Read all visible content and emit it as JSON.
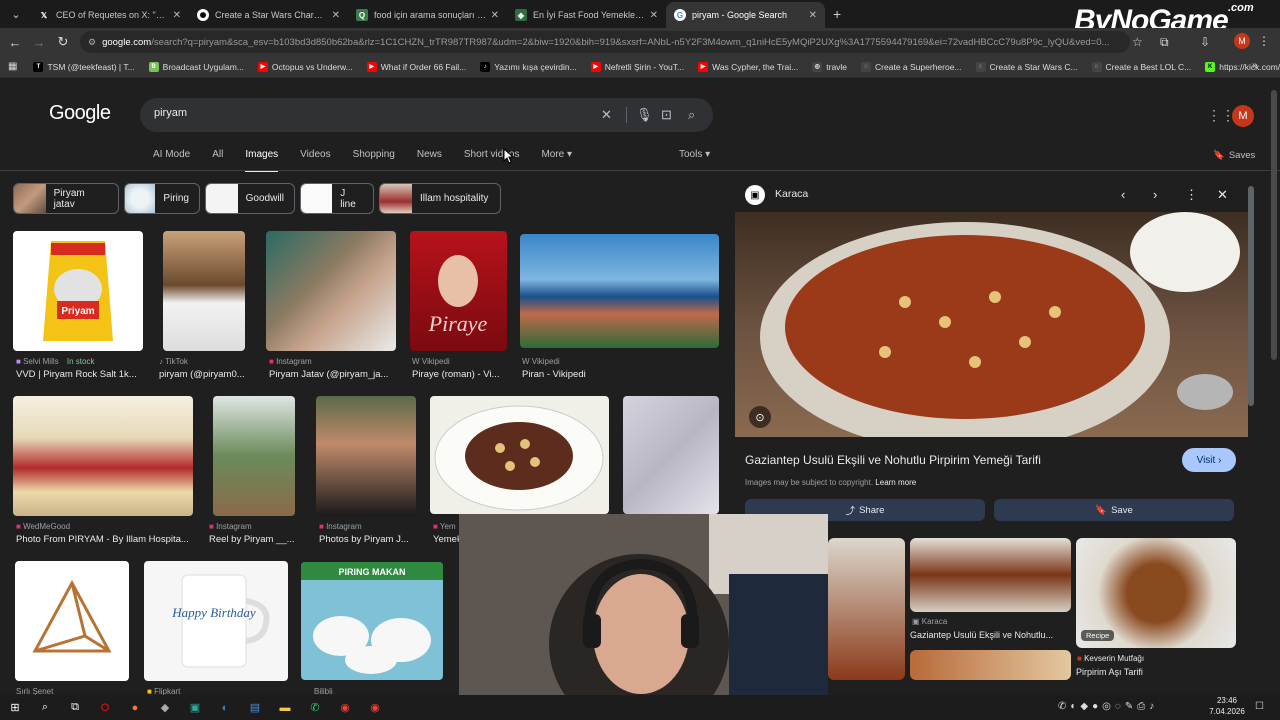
{
  "tabs": [
    {
      "title": "CEO of Requetes on X: \"Esto",
      "icon": "x-logo"
    },
    {
      "title": "Create a Star Wars Characters (",
      "icon": "chatgpt-icon"
    },
    {
      "title": "food için arama sonuçları - Qu",
      "icon": "quora-icon"
    },
    {
      "title": "En İyi Fast Food Yemekleri - Tie",
      "icon": "page-icon"
    },
    {
      "title": "piryam - Google Search",
      "icon": "google-icon",
      "active": true
    }
  ],
  "address": {
    "host": "google.com",
    "rest": "/search?q=piryam&sca_esv=b103bd3d850b62ba&rlz=1C1CHZN_trTR987TR987&udm=2&biw=1920&bih=919&sxsrf=ANbL-n5Y2F3M4owm_q1niHcE5yMQiP2UXg%3A1775594479169&ei=72vadHBCcC79u8P9c_lyQU&ved=0..."
  },
  "bookmarks": [
    {
      "label": "TSM (@teekfeast) | T...",
      "color": "#000000",
      "glyph": "T"
    },
    {
      "label": "Broadcast Uygulam...",
      "color": "#78c257",
      "glyph": "B"
    },
    {
      "label": "Octopus vs Underw...",
      "color": "#ff0000",
      "glyph": "▶"
    },
    {
      "label": "What if Order 66 Fail...",
      "color": "#ff0000",
      "glyph": "▶"
    },
    {
      "label": "Yazımı kışa çevirdin...",
      "color": "#000000",
      "glyph": "♪"
    },
    {
      "label": "Nefretli Şirin - YouT...",
      "color": "#ff0000",
      "glyph": "▶"
    },
    {
      "label": "Was Cypher, the Trai...",
      "color": "#ff0000",
      "glyph": "▶"
    },
    {
      "label": "travle",
      "color": "#444444",
      "glyph": "◎"
    },
    {
      "label": "Create a Superheroe...",
      "color": "#444444",
      "glyph": "◌"
    },
    {
      "label": "Create a Star Wars C...",
      "color": "#444444",
      "glyph": "◌"
    },
    {
      "label": "Create a Best LOL C...",
      "color": "#444444",
      "glyph": "◌"
    },
    {
      "label": "https://kick.com/m...",
      "color": "#53fc18",
      "glyph": "K"
    }
  ],
  "watermark": {
    "main": "ByNoGame",
    "sup": ".com"
  },
  "google": {
    "logo": "Google",
    "query": "piryam",
    "tabs": [
      "AI Mode",
      "All",
      "Images",
      "Videos",
      "Shopping",
      "News",
      "Short videos",
      "More ▾"
    ],
    "active_tab": "Images",
    "tools": "Tools ▾",
    "saves": "Saves",
    "avatar": "M"
  },
  "chips": [
    "Piryam jatav",
    "Piring",
    "Goodwill",
    "J line",
    "Illam hospitality"
  ],
  "results": {
    "row1": [
      {
        "source": "Selvi Mills",
        "badge": "In stock",
        "caption": "VVD | Piryam Rock Salt 1k..."
      },
      {
        "source": "TikTok",
        "caption": "piryam (@piryam0..."
      },
      {
        "source": "Instagram",
        "caption": "Piryam Jatav (@piryam_ja..."
      },
      {
        "source": "Vikipedi",
        "caption": "Piraye (roman) - Vi..."
      },
      {
        "source": "Vikipedi",
        "caption": "Piran - Vikipedi"
      }
    ],
    "row2": [
      {
        "source": "WedMeGood",
        "caption": "Photo From PIRYAM - By Illam Hospita..."
      },
      {
        "source": "Instagram",
        "caption": "Reel by Piryam __..."
      },
      {
        "source": "Instagram",
        "caption": "Photos by Piryam J..."
      },
      {
        "source": "Yem",
        "caption": "Yemek"
      }
    ],
    "row3": [
      {
        "source": "Sırlı Şenet"
      },
      {
        "source": "Flipkart"
      },
      {
        "source": "Bilibli"
      }
    ],
    "piring_text": "PIRING MAKAN",
    "mug_text": "Happy Birthday"
  },
  "panel": {
    "site": "Karaca",
    "title": "Gaziantep Usulü Ekşili ve Nohutlu Pirpirim Yemeği Tarifi",
    "visit": "Visit ›",
    "copyright": "Images may be subject to copyright.",
    "learn_more": "Learn more",
    "share": "Share",
    "save": "Save",
    "related": [
      {
        "source": "Karaca",
        "caption": "Gaziantep Usulü Ekşili ve Nohutlu..."
      },
      {
        "source": "Kevserin Mutfağı",
        "caption": "Pirpirim Aşı Tarifi",
        "badge": "Recipe"
      }
    ]
  },
  "clock": {
    "time": "23:46",
    "date": "7.04.2026"
  }
}
